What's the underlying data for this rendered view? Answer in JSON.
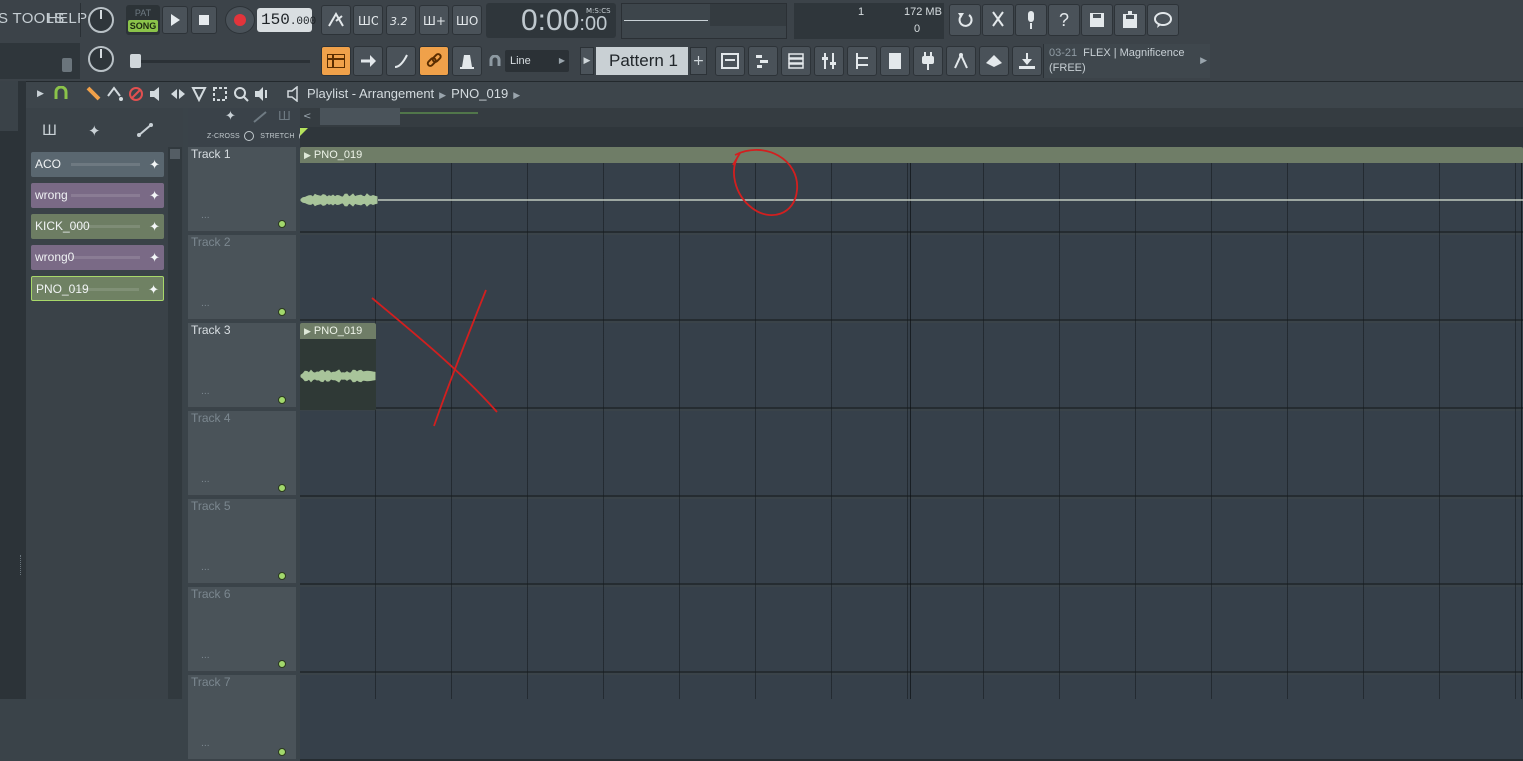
{
  "menu": {
    "tools_fragment": "S TOOLS",
    "help": "HELP"
  },
  "transport": {
    "pat_label": "PAT",
    "song_label": "SONG",
    "tempo_main": "150",
    "tempo_frac": ".000",
    "time_main": "0:00",
    "time_small": ":00",
    "time_unit": "M:S:CS"
  },
  "monitor": {
    "cpu": "1",
    "memory": "172 MB",
    "polyphony": "0"
  },
  "toolbar2": {
    "snap": "Line",
    "pattern_name": "Pattern 1",
    "hint_code": "03-21",
    "hint_line1": "FLEX | Magnificence",
    "hint_line2": "(FREE)"
  },
  "playlist": {
    "title": "Playlist - Arrangement",
    "current_clip": "PNO_019",
    "zcross": "Z-CROSS",
    "stretch": "STRETCH"
  },
  "clip_picker": [
    {
      "name": "ACO",
      "color": "#5a6770"
    },
    {
      "name": "wrong",
      "color": "#7a6a86"
    },
    {
      "name": "KICK_000",
      "color": "#6d7d63"
    },
    {
      "name": "wrong0",
      "color": "#7a6a86"
    },
    {
      "name": "PNO_019",
      "color": "#6f8163",
      "selected": true
    }
  ],
  "tracks": [
    {
      "name": "Track 1",
      "active": true
    },
    {
      "name": "Track 2",
      "active": false
    },
    {
      "name": "Track 3",
      "active": true
    },
    {
      "name": "Track 4",
      "active": false
    },
    {
      "name": "Track 5",
      "active": false
    },
    {
      "name": "Track 6",
      "active": false
    },
    {
      "name": "Track 7",
      "active": false
    }
  ],
  "clips": [
    {
      "label": "PNO_019",
      "track": "Track 1"
    },
    {
      "label": "PNO_019",
      "track": "Track 3"
    }
  ],
  "colors": {
    "accent_green": "#8bc34a",
    "annotation_red": "#d21f1f",
    "selected_outline": "#a8d86a"
  }
}
